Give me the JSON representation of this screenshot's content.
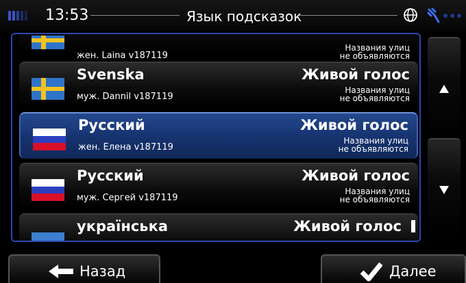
{
  "status": {
    "time": "13:53",
    "title": "Язык подсказок"
  },
  "icons": {
    "signal": "signal-bars-icon",
    "globe": "globe-icon",
    "gps": "gps-satellite-icon"
  },
  "languages": [
    {
      "language": "",
      "voice": "жен. Laina v187119",
      "voice_type": "",
      "street_names_line1": "Названия улиц",
      "street_names_line2": "не объявляются",
      "flag": "sweden-flag-icon",
      "selected": false
    },
    {
      "language": "Svenska",
      "voice": "муж. Dannil v187119",
      "voice_type": "Живой голос",
      "street_names_line1": "Названия улиц",
      "street_names_line2": "не объявляются",
      "flag": "sweden-flag-icon",
      "selected": false
    },
    {
      "language": "Русский",
      "voice": "жен. Елена v187119",
      "voice_type": "Живой голос",
      "street_names_line1": "Названия улиц",
      "street_names_line2": "не объявляются",
      "flag": "russia-flag-icon",
      "selected": true
    },
    {
      "language": "Русский",
      "voice": "муж. Сергей v187119",
      "voice_type": "Живой голос",
      "street_names_line1": "Названия улиц",
      "street_names_line2": "не объявляются",
      "flag": "russia-flag-icon",
      "selected": false
    },
    {
      "language": "українська",
      "voice": "",
      "voice_type": "Живой голос",
      "street_names_line1": "",
      "street_names_line2": "",
      "flag": "ukraine-flag-icon",
      "selected": false
    }
  ],
  "footer": {
    "back_label": "Назад",
    "next_label": "Далее"
  },
  "colors": {
    "accent": "#2a49b0",
    "selected_row": "#173471"
  }
}
